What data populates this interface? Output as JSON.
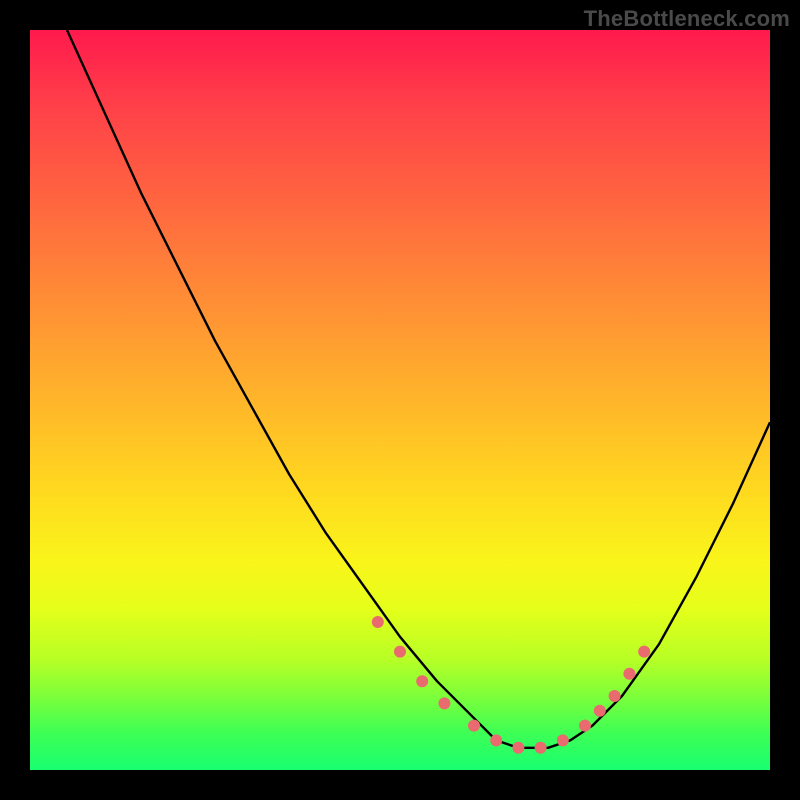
{
  "watermark": "TheBottleneck.com",
  "chart_data": {
    "type": "line",
    "title": "",
    "xlabel": "",
    "ylabel": "",
    "xlim": [
      0,
      100
    ],
    "ylim": [
      0,
      100
    ],
    "grid": false,
    "series": [
      {
        "name": "bottleneck-curve",
        "x": [
          5,
          10,
          15,
          20,
          25,
          30,
          35,
          40,
          45,
          50,
          55,
          60,
          63,
          66,
          70,
          73,
          76,
          80,
          85,
          90,
          95,
          100
        ],
        "values": [
          100,
          89,
          78,
          68,
          58,
          49,
          40,
          32,
          25,
          18,
          12,
          7,
          4,
          3,
          3,
          4,
          6,
          10,
          17,
          26,
          36,
          47
        ]
      }
    ],
    "markers": {
      "name": "highlight-points",
      "color": "#e96a6f",
      "x": [
        47,
        50,
        53,
        56,
        60,
        63,
        66,
        69,
        72,
        75,
        77,
        79,
        81,
        83
      ],
      "values": [
        20,
        16,
        12,
        9,
        6,
        4,
        3,
        3,
        4,
        6,
        8,
        10,
        13,
        16
      ]
    }
  }
}
